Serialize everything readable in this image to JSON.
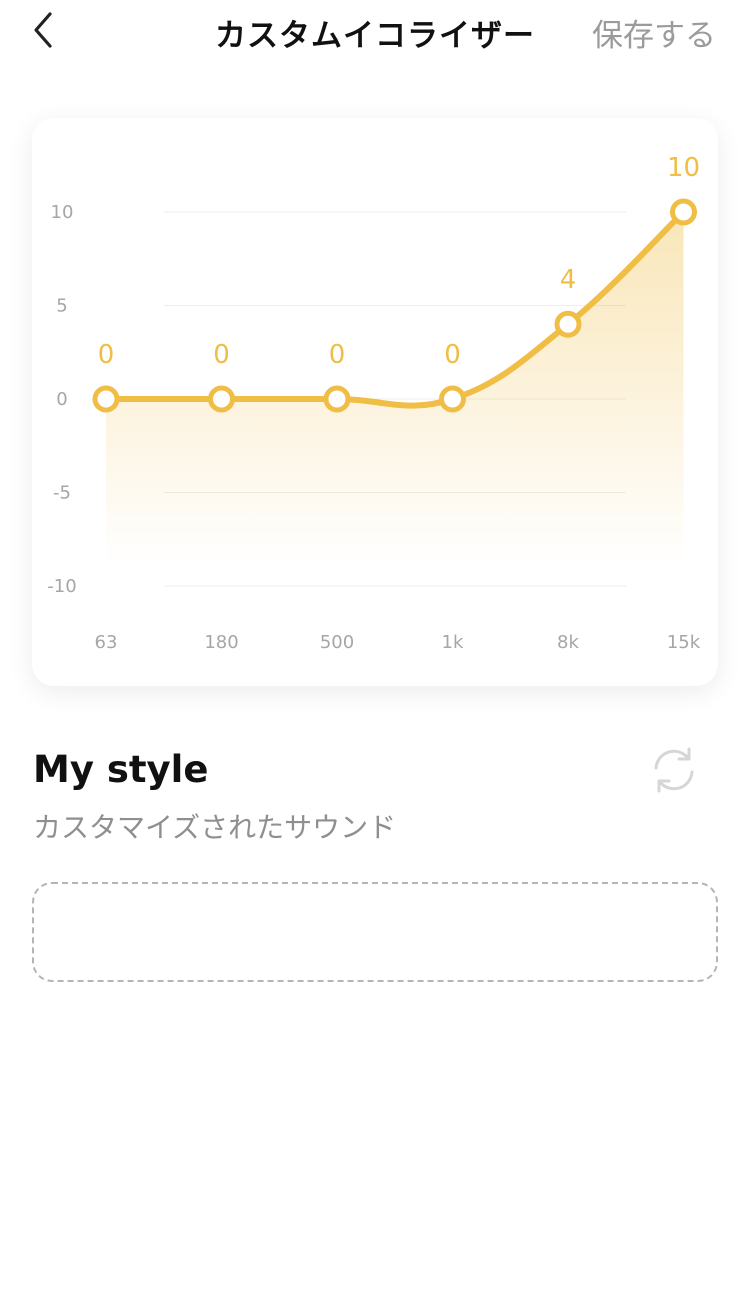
{
  "header": {
    "title": "カスタムイコライザー",
    "save_label": "保存する",
    "back_icon": "chevron-left-icon"
  },
  "colors": {
    "accent": "#f0bd45",
    "grid": "#eeeeee",
    "tick": "#a6a6a6"
  },
  "chart_data": {
    "type": "line",
    "categories": [
      "63",
      "180",
      "500",
      "1k",
      "8k",
      "15k"
    ],
    "values": [
      0,
      0,
      0,
      0,
      4,
      10
    ],
    "yticks": [
      10,
      5,
      0,
      -5,
      -10
    ],
    "ylim": [
      -10,
      10
    ],
    "grid": true,
    "smooth": true,
    "area_fill": true
  },
  "style": {
    "name": "My style",
    "subtitle": "カスタマイズされたサウンド",
    "reset_icon": "refresh-icon"
  }
}
